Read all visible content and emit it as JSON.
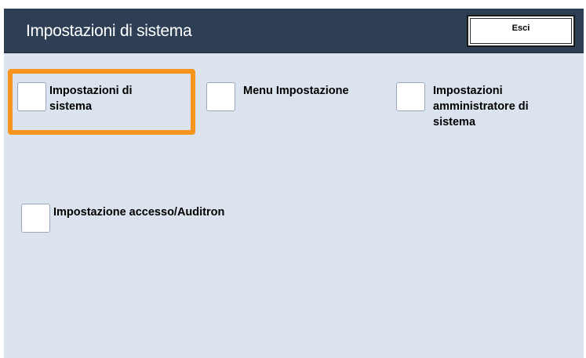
{
  "header": {
    "title": "Impostazioni di sistema",
    "exit_label": "Esci"
  },
  "options": [
    {
      "label_line1": "Impostazioni di",
      "label_line2": "sistema",
      "label_line3": ""
    },
    {
      "label_line1": "Menu Impostazione",
      "label_line2": "",
      "label_line3": ""
    },
    {
      "label_line1": "Impostazioni",
      "label_line2": "amministratore di",
      "label_line3": "sistema"
    },
    {
      "label_line1": "Impostazione accesso/Auditron",
      "label_line2": "",
      "label_line3": ""
    }
  ],
  "selection": {
    "highlight_color": "#f7941d",
    "selected_option": "Impostazioni di sistema"
  },
  "colors": {
    "header_bg": "#2e3f55",
    "panel_bg": "#dbe3ee"
  }
}
